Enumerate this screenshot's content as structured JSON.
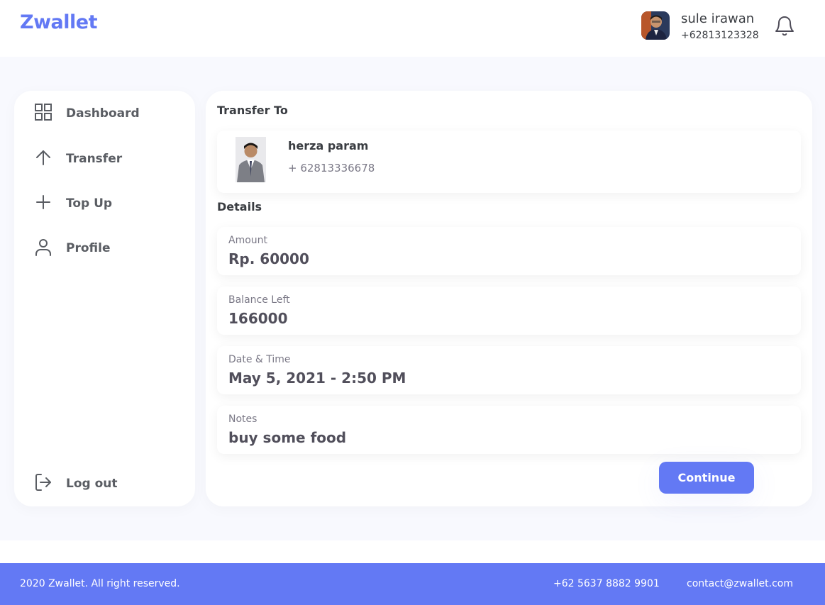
{
  "header": {
    "brand": "Zwallet",
    "user_name": "sule irawan",
    "user_phone": "+62813123328"
  },
  "sidebar": {
    "items": [
      {
        "label": "Dashboard",
        "icon": "grid-icon"
      },
      {
        "label": "Transfer",
        "icon": "arrow-up-icon"
      },
      {
        "label": "Top Up",
        "icon": "plus-icon"
      },
      {
        "label": "Profile",
        "icon": "user-icon"
      }
    ],
    "logout_label": "Log out"
  },
  "transfer": {
    "title": "Transfer To",
    "recipient_name": "herza param",
    "recipient_phone": "+ 62813336678"
  },
  "details": {
    "title": "Details",
    "items": [
      {
        "label": "Amount",
        "value": "Rp. 60000"
      },
      {
        "label": "Balance Left",
        "value": "166000"
      },
      {
        "label": "Date & Time",
        "value": "May 5, 2021 - 2:50 PM"
      },
      {
        "label": "Notes",
        "value": "buy some food"
      }
    ],
    "continue_label": "Continue"
  },
  "footer": {
    "copyright": "2020 Zwallet. All right reserved.",
    "phone": "+62 5637 8882 9901",
    "email": "contact@zwallet.com"
  },
  "colors": {
    "primary": "#6379f4",
    "background": "#f8f9fe"
  }
}
